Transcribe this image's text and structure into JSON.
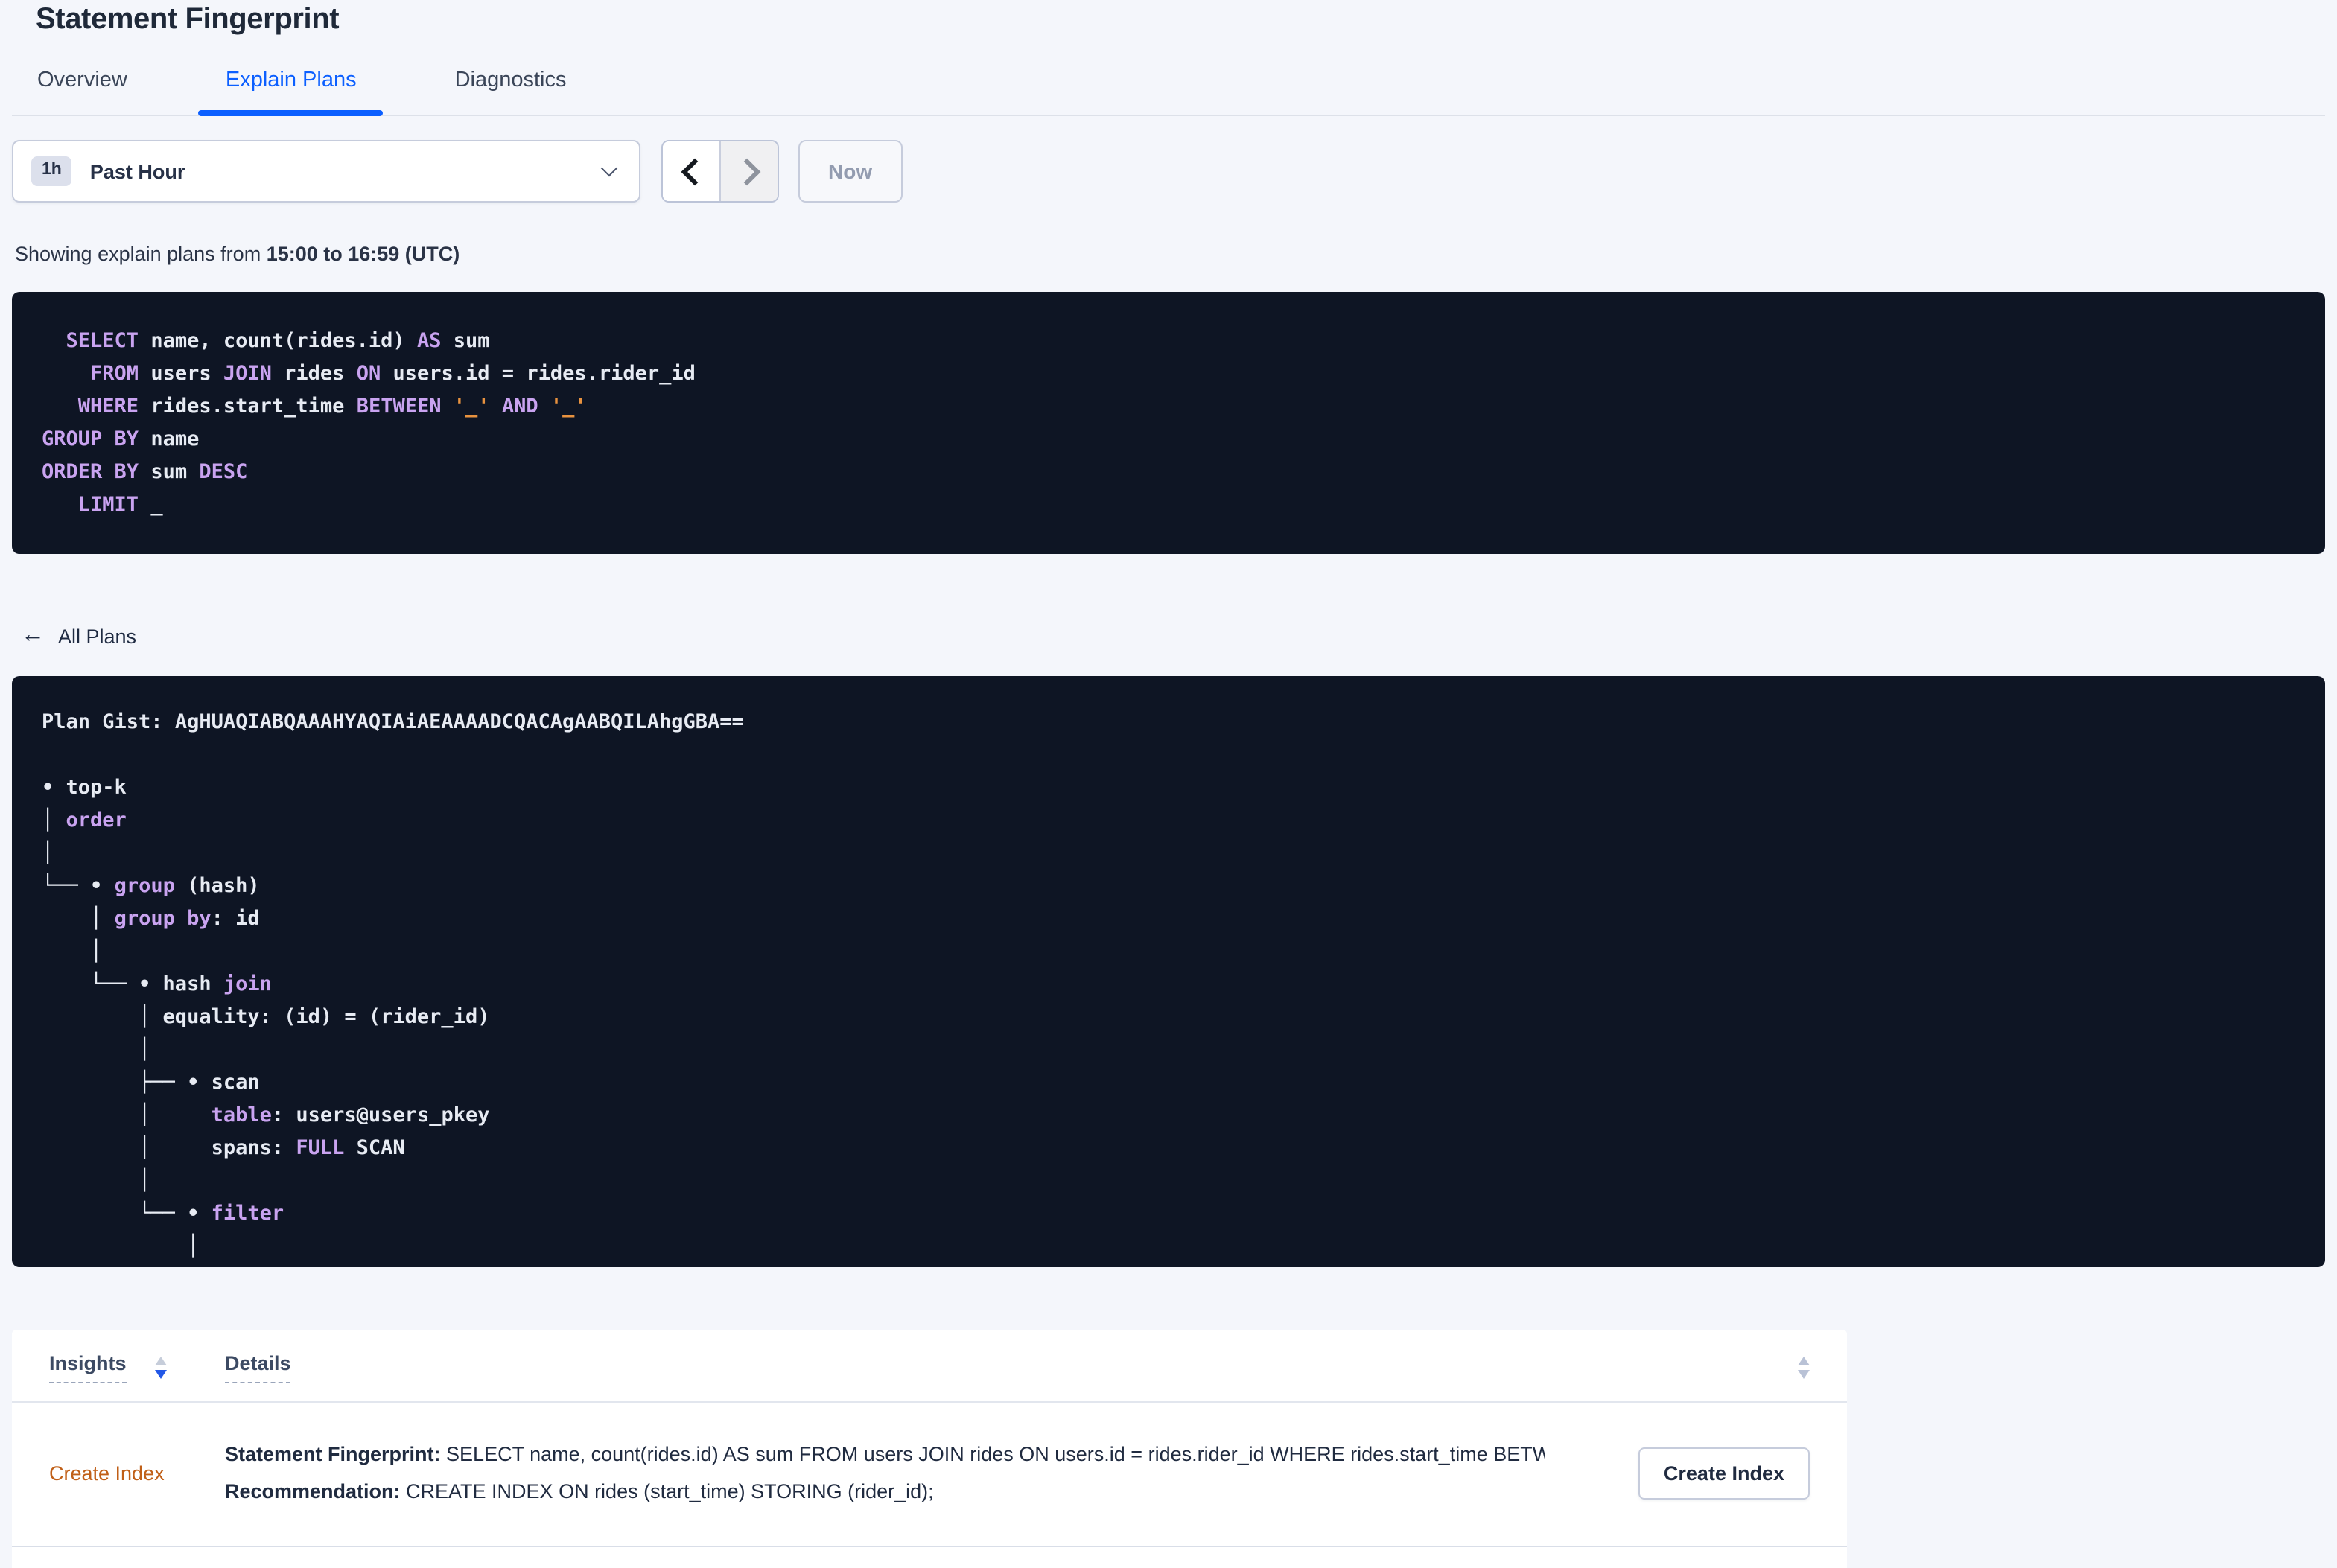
{
  "page": {
    "title": "Statement Fingerprint"
  },
  "tabs": [
    {
      "label": "Overview",
      "active": false
    },
    {
      "label": "Explain Plans",
      "active": true
    },
    {
      "label": "Diagnostics",
      "active": false
    }
  ],
  "time_selector": {
    "badge": "1h",
    "label": "Past Hour",
    "now_label": "Now"
  },
  "showing": {
    "prefix": "Showing explain plans from ",
    "range": "15:00 to 16:59 (UTC)"
  },
  "sql": {
    "lines": [
      [
        [
          "k",
          "  SELECT"
        ],
        [
          "w",
          " name, count(rides.id) "
        ],
        [
          "k",
          "AS"
        ],
        [
          "w",
          " sum"
        ]
      ],
      [
        [
          "k",
          "    FROM"
        ],
        [
          "w",
          " users "
        ],
        [
          "k",
          "JOIN"
        ],
        [
          "w",
          " rides "
        ],
        [
          "k",
          "ON"
        ],
        [
          "w",
          " users.id = rides.rider_id"
        ]
      ],
      [
        [
          "k",
          "   WHERE"
        ],
        [
          "w",
          " rides.start_time "
        ],
        [
          "k",
          "BETWEEN"
        ],
        [
          "w",
          " "
        ],
        [
          "o",
          "'_'"
        ],
        [
          "k",
          " AND"
        ],
        [
          "w",
          " "
        ],
        [
          "o",
          "'_'"
        ]
      ],
      [
        [
          "k",
          "GROUP BY"
        ],
        [
          "w",
          " name"
        ]
      ],
      [
        [
          "k",
          "ORDER BY"
        ],
        [
          "w",
          " sum "
        ],
        [
          "k",
          "DESC"
        ]
      ],
      [
        [
          "k",
          "   LIMIT"
        ],
        [
          "w",
          " _"
        ]
      ]
    ]
  },
  "all_plans": {
    "label": "All Plans",
    "arrow": "←"
  },
  "plan": {
    "gist_label": "Plan Gist: ",
    "gist": "AgHUAQIABQAAAHYAQIAiAEAAAADCQACAgAABQILAhgGBA==",
    "tree": [
      [
        [
          "w",
          "• top-k"
        ]
      ],
      [
        [
          "w",
          "│ "
        ],
        [
          "k",
          "order"
        ]
      ],
      [
        [
          "w",
          "│"
        ]
      ],
      [
        [
          "w",
          "└── • "
        ],
        [
          "k",
          "group"
        ],
        [
          "w",
          " (hash)"
        ]
      ],
      [
        [
          "w",
          "    │ "
        ],
        [
          "k",
          "group by"
        ],
        [
          "w",
          ": id"
        ]
      ],
      [
        [
          "w",
          "    │"
        ]
      ],
      [
        [
          "w",
          "    └── • hash "
        ],
        [
          "k",
          "join"
        ]
      ],
      [
        [
          "w",
          "        │ equality: (id) = (rider_id)"
        ]
      ],
      [
        [
          "w",
          "        │"
        ]
      ],
      [
        [
          "w",
          "        ├── • scan"
        ]
      ],
      [
        [
          "w",
          "        │     "
        ],
        [
          "k",
          "table"
        ],
        [
          "w",
          ": users@users_pkey"
        ]
      ],
      [
        [
          "w",
          "        │     spans: "
        ],
        [
          "k",
          "FULL"
        ],
        [
          "w",
          " SCAN"
        ]
      ],
      [
        [
          "w",
          "        │"
        ]
      ],
      [
        [
          "w",
          "        └── • "
        ],
        [
          "k",
          "filter"
        ]
      ],
      [
        [
          "w",
          "            │"
        ]
      ]
    ]
  },
  "insights_table": {
    "columns": {
      "insights": "Insights",
      "details": "Details"
    },
    "row": {
      "insight": "Create Index",
      "details": [
        {
          "label": "Statement Fingerprint:",
          "text": " SELECT name, count(rides.id) AS sum FROM users JOIN rides ON users.id = rides.rider_id WHERE rides.start_time BETWEEN '_…"
        },
        {
          "label": "Recommendation:",
          "text": " CREATE INDEX ON rides (start_time) STORING (rider_id);"
        }
      ],
      "action_label": "Create Index"
    }
  },
  "colors": {
    "accent_blue": "#0b5fff",
    "code_background": "#0e1524",
    "code_keyword": "#c9a3f0",
    "code_identifier": "#e7ebf3",
    "code_literal": "#e8923f",
    "insight_orange": "#c05f17",
    "sort_active_blue": "#2257e7",
    "page_background": "#f4f6fb"
  }
}
